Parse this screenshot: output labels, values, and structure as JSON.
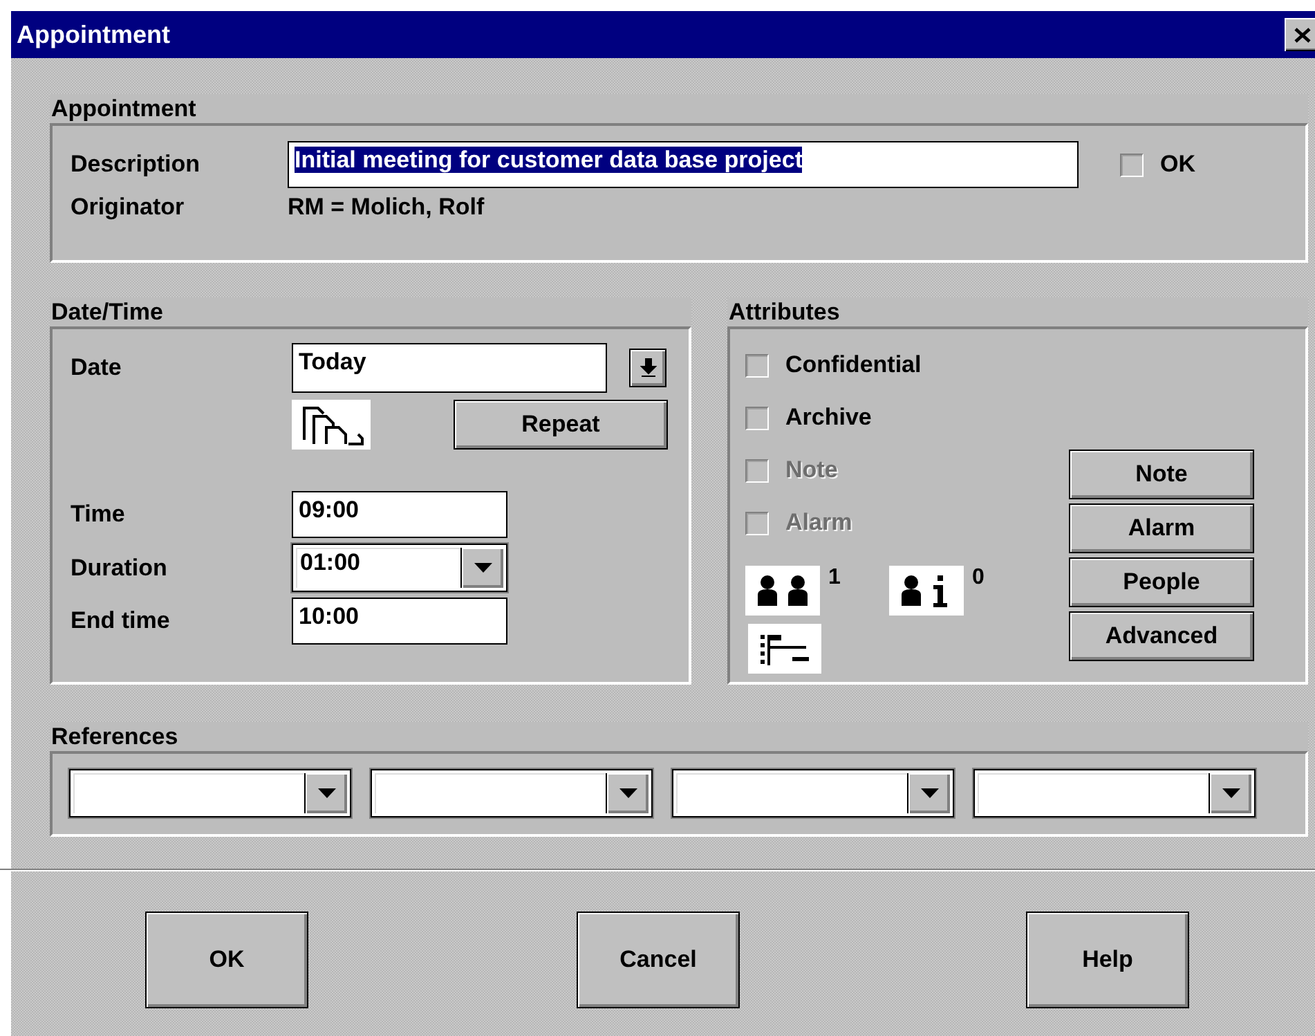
{
  "window": {
    "title": "Appointment"
  },
  "appointment": {
    "title": "Appointment",
    "description": {
      "label": "Description",
      "value": "Initial meeting for customer data base project",
      "value_selected": true
    },
    "ok_checkbox": {
      "label": "OK",
      "checked": false
    },
    "originator": {
      "label": "Originator",
      "value": "RM = Molich, Rolf"
    }
  },
  "date_time": {
    "title": "Date/Time",
    "date": {
      "label": "Date",
      "value": "Today"
    },
    "repeat_button": "Repeat",
    "time": {
      "label": "Time",
      "value": "09:00"
    },
    "duration": {
      "label": "Duration",
      "value": "01:00"
    },
    "end_time": {
      "label": "End time",
      "value": "10:00"
    }
  },
  "attributes": {
    "title": "Attributes",
    "checkboxes": [
      {
        "label": "Confidential",
        "checked": false,
        "disabled": false
      },
      {
        "label": "Archive",
        "checked": false,
        "disabled": false
      },
      {
        "label": "Note",
        "checked": false,
        "disabled": true
      },
      {
        "label": "Alarm",
        "checked": false,
        "disabled": true
      }
    ],
    "participants_count": "1",
    "info_count": "0",
    "buttons": [
      "Note",
      "Alarm",
      "People",
      "Advanced"
    ]
  },
  "references": {
    "title": "References",
    "dropdowns": [
      {
        "kind": "combo"
      },
      {
        "kind": "combo"
      },
      {
        "kind": "combo"
      },
      {
        "kind": "combo"
      }
    ]
  },
  "buttons": [
    "OK",
    "Cancel",
    "Help"
  ]
}
